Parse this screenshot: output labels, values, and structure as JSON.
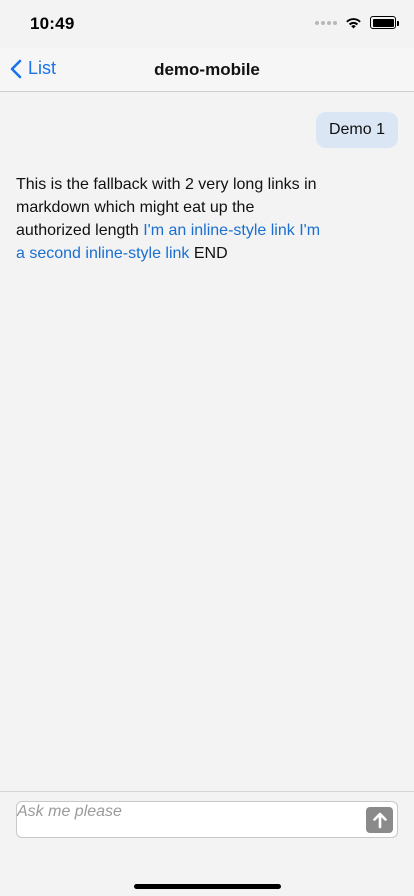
{
  "status_bar": {
    "time": "10:49",
    "icons": [
      "signal-icon",
      "wifi-icon",
      "battery-icon"
    ]
  },
  "nav": {
    "back_label": "List",
    "back_icon": "chevron-left-icon",
    "title": "demo-mobile"
  },
  "chat": {
    "user_message": "Demo 1",
    "bot_message": {
      "text_before": "This is the fallback with 2 very long links in markdown which might eat up the authorized length ",
      "link1": "I'm an inline-style link",
      "link2": "I'm a second inline-style link",
      "text_after": " END"
    }
  },
  "composer": {
    "placeholder": "Ask me please",
    "value": "",
    "send_icon": "arrow-up-icon"
  },
  "colors": {
    "accent": "#1a73e8",
    "link": "#1a6fd1",
    "user_bubble": "#dbe6f5",
    "background": "#f3f3f3",
    "send_button": "#8a8a8a"
  }
}
